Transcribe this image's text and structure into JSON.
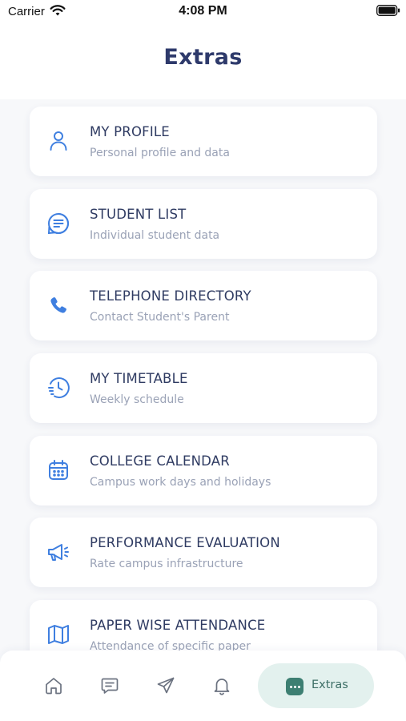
{
  "status_bar": {
    "carrier": "Carrier",
    "time": "4:08 PM"
  },
  "header": {
    "title": "Extras"
  },
  "menu": {
    "items": [
      {
        "title": "MY PROFILE",
        "subtitle": "Personal profile and data",
        "icon": "person-icon"
      },
      {
        "title": "STUDENT LIST",
        "subtitle": "Individual student data",
        "icon": "list-icon"
      },
      {
        "title": "TELEPHONE DIRECTORY",
        "subtitle": "Contact Student's Parent",
        "icon": "phone-icon"
      },
      {
        "title": "MY TIMETABLE",
        "subtitle": "Weekly schedule",
        "icon": "clock-history-icon"
      },
      {
        "title": "COLLEGE CALENDAR",
        "subtitle": "Campus work days and holidays",
        "icon": "calendar-icon"
      },
      {
        "title": "PERFORMANCE EVALUATION",
        "subtitle": "Rate campus infrastructure",
        "icon": "megaphone-icon"
      },
      {
        "title": "PAPER WISE ATTENDANCE",
        "subtitle": "Attendance of specific paper",
        "icon": "map-icon"
      }
    ]
  },
  "tab_bar": {
    "tabs": [
      {
        "icon": "home-icon"
      },
      {
        "icon": "chat-icon"
      },
      {
        "icon": "send-icon"
      },
      {
        "icon": "bell-icon"
      },
      {
        "icon": "more-icon",
        "label": "Extras",
        "active": true
      }
    ]
  },
  "colors": {
    "title": "#2e3a6b",
    "icon_blue": "#3f7fe0",
    "active_tab_bg": "#e3f1ee",
    "active_tab_icon": "#3d7f72",
    "tab_icon": "#6b7280"
  }
}
